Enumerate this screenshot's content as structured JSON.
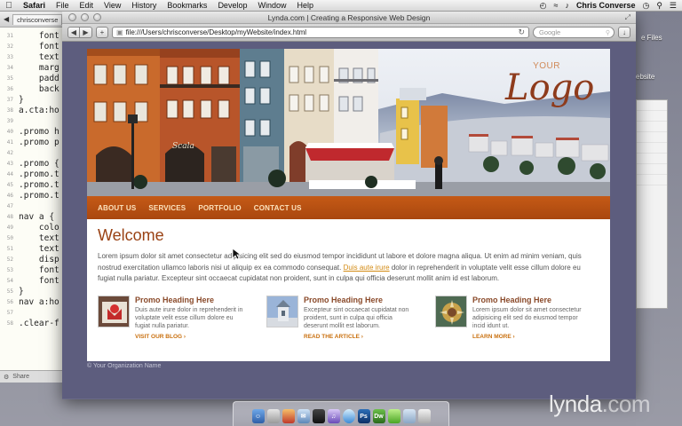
{
  "menubar": {
    "app": "Safari",
    "items": [
      "File",
      "Edit",
      "View",
      "History",
      "Bookmarks",
      "Develop",
      "Window",
      "Help"
    ],
    "user": "Chris Converse"
  },
  "editor": {
    "tab": "chrisconverse",
    "lines": [
      "31",
      "32",
      "33",
      "34",
      "35",
      "36",
      "37",
      "38",
      "39",
      "40",
      "41",
      "42",
      "43",
      "44",
      "45",
      "46",
      "47",
      "48",
      "49",
      "50",
      "51",
      "52",
      "53",
      "54",
      "55",
      "56",
      "57",
      "58"
    ],
    "code": [
      "    font",
      "    font",
      "    text",
      "    marg",
      "    padd",
      "    back",
      "}",
      "a.cta:ho",
      "",
      ".promo h",
      ".promo p",
      "",
      ".promo {",
      ".promo.t",
      ".promo.t",
      ".promo.t",
      "",
      "nav a {",
      "    colo",
      "    text",
      "    text",
      "    disp",
      "    font",
      "    font",
      "}",
      "nav a:ho",
      "",
      ".clear-f"
    ],
    "status_share": "Share"
  },
  "finder": {
    "label1": "e Files",
    "label2": "ebsite"
  },
  "browser": {
    "title": "Lynda.com | Creating a Responsive Web Design",
    "address": "file:///Users/chrisconverse/Desktop/myWebsite/index.html",
    "search_placeholder": "Google"
  },
  "site": {
    "logo_small": "YOUR",
    "logo_large": "Logo",
    "nav": [
      "ABOUT US",
      "SERVICES",
      "PORTFOLIO",
      "CONTACT US"
    ],
    "heading": "Welcome",
    "lede_before": "Lorem ipsum dolor sit amet consectetur adipisicing elit sed do eiusmod tempor incididunt ut labore et dolore magna aliqua. Ut enim ad minim veniam, quis nostrud exercitation ullamco laboris nisi ut aliquip ex ea commodo consequat. ",
    "lede_link": "Duis aute irure",
    "lede_after": " dolor in reprehenderit in voluptate velit esse cillum dolore eu fugiat nulla pariatur. Excepteur sint occaecat cupidatat non proident, sunt in culpa qui officia deserunt mollit anim id est laborum.",
    "promos": [
      {
        "heading": "Promo Heading Here",
        "text": "Duis aute irure dolor in reprehenderit in voluptate velit esse cillum dolore eu fugiat nulla pariatur.",
        "link": "VISIT OUR BLOG ›"
      },
      {
        "heading": "Promo Heading Here",
        "text": "Excepteur sint occaecat cupidatat non proident, sunt in culpa qui officia deserunt mollit est laborum.",
        "link": "READ THE ARTICLE ›"
      },
      {
        "heading": "Promo Heading Here",
        "text": "Lorem ipsum dolor sit amet consectetur adipisicing elit sed do eiusmod tempor incid idunt ut.",
        "link": "LEARN MORE ›"
      }
    ],
    "footer": "© Your Organization Name"
  },
  "dock": {
    "icons": [
      "finder-icon",
      "preview-icon",
      "photos-icon",
      "mail-icon",
      "terminal-icon",
      "itunes-icon",
      "safari-icon",
      "photoshop-icon",
      "dreamweaver-icon",
      "messages-icon",
      "folder-icon",
      "trash-icon"
    ],
    "ps": "Ps",
    "dw": "Dw"
  },
  "watermark": {
    "a": "lynda",
    "b": ".com"
  }
}
